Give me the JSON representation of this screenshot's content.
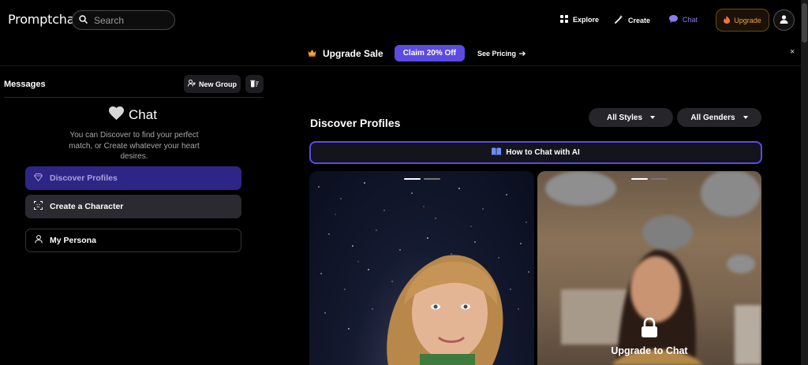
{
  "header": {
    "logo": "Promptchan",
    "search_placeholder": "Search",
    "nav": {
      "explore": "Explore",
      "create": "Create",
      "chat": "Chat",
      "upgrade": "Upgrade"
    }
  },
  "banner": {
    "sale_text": "Upgrade Sale",
    "claim_label": "Claim 20% Off",
    "pricing_label": "See Pricing",
    "close": "×"
  },
  "sidebar": {
    "title": "Messages",
    "new_group": "New Group",
    "chat_heading": "Chat",
    "chat_description": "You can Discover to find your perfect match, or Create whatever your heart desires.",
    "buttons": {
      "discover": "Discover Profiles",
      "create": "Create a Character",
      "persona": "My Persona"
    }
  },
  "main": {
    "title": "Discover Profiles",
    "filters": {
      "styles": "All Styles",
      "genders": "All Genders"
    },
    "howto_label": "How to Chat with AI",
    "cards": [
      {
        "locked": false,
        "indicator_active": 0
      },
      {
        "locked": true,
        "indicator_active": 0,
        "lock_text": "Upgrade to Chat"
      }
    ]
  },
  "colors": {
    "accent": "#5b4be0",
    "chat_nav": "#8a7cf0",
    "upgrade": "#f0a43a",
    "discover_btn": "#2e2686"
  }
}
